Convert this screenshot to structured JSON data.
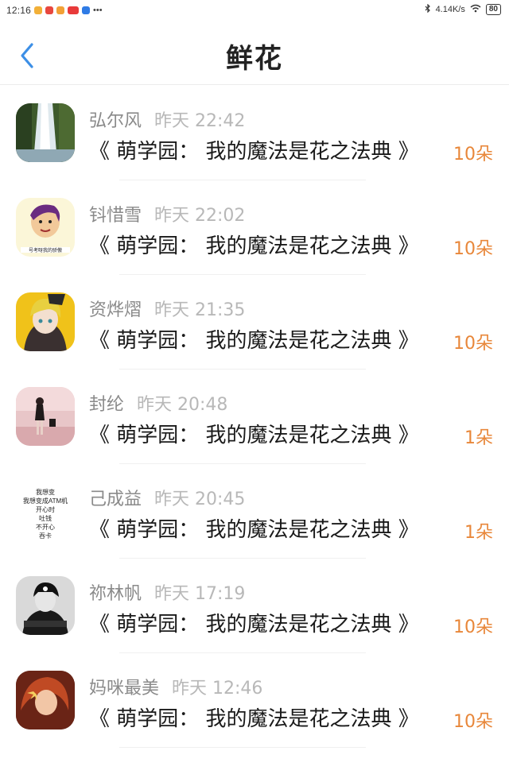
{
  "status_bar": {
    "time": "12:16",
    "speed": "4.14K/s",
    "battery": "80",
    "app_colors": [
      "#f2b038",
      "#e8473f",
      "#f2a136",
      "#e83a3a",
      "#2f7be5"
    ]
  },
  "header": {
    "title": "鲜花",
    "back_color": "#3d8fe6"
  },
  "accent_color": "#e8873a",
  "records": [
    {
      "name": "弘尔风",
      "time": "昨天 22:42",
      "book": "《 萌学园： 我的魔法是花之法典 》",
      "amount": "10朵",
      "avatar": "waterfall"
    },
    {
      "name": "钭惜雪",
      "time": "昨天 22:02",
      "book": "《 萌学园： 我的魔法是花之法典 》",
      "amount": "10朵",
      "avatar": "cartoon-girl"
    },
    {
      "name": "资烨熠",
      "time": "昨天 21:35",
      "book": "《 萌学园： 我的魔法是花之法典 》",
      "amount": "10朵",
      "avatar": "anime-character"
    },
    {
      "name": "封纶",
      "time": "昨天 20:48",
      "book": "《 萌学园： 我的魔法是花之法典 》",
      "amount": "1朵",
      "avatar": "girl-pink-street"
    },
    {
      "name": "己成益",
      "time": "昨天 20:45",
      "book": "《 萌学园： 我的魔法是花之法典 》",
      "amount": "1朵",
      "avatar": "text-image",
      "avatar_text": [
        "我想变",
        "我想变成ATM机",
        "开心时",
        "吐钱",
        "不开心",
        "吞卡"
      ]
    },
    {
      "name": "祢林帆",
      "time": "昨天 17:19",
      "book": "《 萌学园： 我的魔法是花之法典 》",
      "amount": "10朵",
      "avatar": "bw-photo"
    },
    {
      "name": "妈咪最美",
      "time": "昨天 12:46",
      "book": "《 萌学园： 我的魔法是花之法典 》",
      "amount": "10朵",
      "avatar": "red-hair-anime"
    }
  ]
}
